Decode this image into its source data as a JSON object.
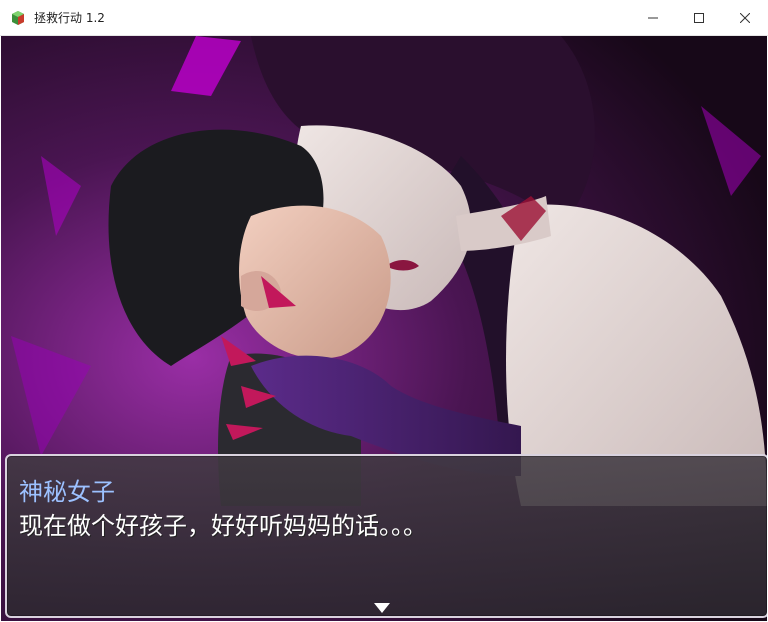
{
  "window": {
    "title": "拯救行动 1.2",
    "controls": [
      "minimize-icon",
      "maximize-icon",
      "close-icon"
    ]
  },
  "dialog": {
    "speaker": "神秘女子",
    "line": "现在做个好孩子，好好听妈妈的话。。。",
    "continue_indicator": "triangle-down-icon"
  },
  "colors": {
    "speaker": "#9cc1ff",
    "text": "#ffffff",
    "glow": "#b000c8",
    "dialog_bg": "#413a42"
  }
}
